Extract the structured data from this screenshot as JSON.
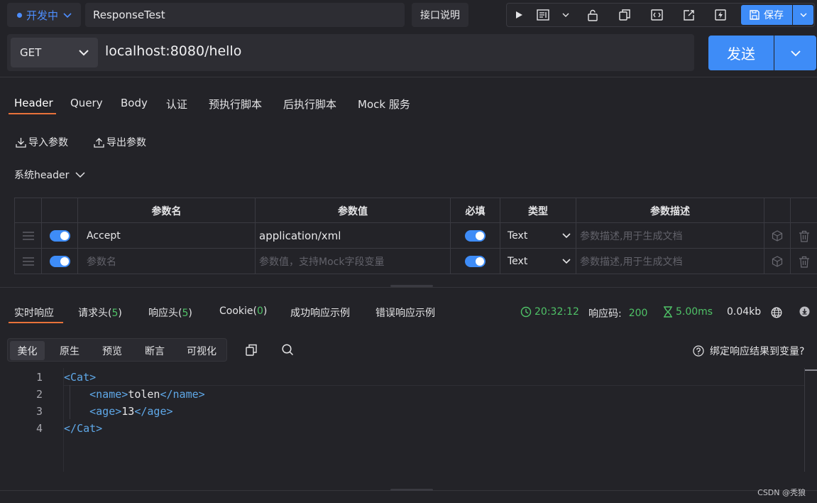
{
  "topbar": {
    "env_label": "开发中",
    "api_name": "ResponseTest",
    "doc_button": "接口说明",
    "save_label": "保存"
  },
  "request": {
    "method": "GET",
    "url": "localhost:8080/hello",
    "send_label": "发送"
  },
  "req_tabs": [
    "Header",
    "Query",
    "Body",
    "认证",
    "预执行脚本",
    "后执行脚本",
    "Mock 服务"
  ],
  "actions": {
    "import": "导入参数",
    "export": "导出参数"
  },
  "system_header_label": "系统header",
  "params_table": {
    "columns": [
      "参数名",
      "参数值",
      "必填",
      "类型",
      "参数描述"
    ],
    "rows": [
      {
        "name": "Accept",
        "value": "application/xml",
        "required": true,
        "type": "Text",
        "desc_placeholder": "参数描述,用于生成文档"
      },
      {
        "name_placeholder": "参数名",
        "value_placeholder": "参数值，支持Mock字段变量",
        "required": true,
        "type": "Text",
        "desc_placeholder": "参数描述,用于生成文档"
      }
    ]
  },
  "response": {
    "tabs": {
      "live": "实时响应",
      "req_headers_label": "请求头(",
      "req_headers_count": "5",
      "res_headers_label": "响应头(",
      "res_headers_count": "5",
      "cookie_label": "Cookie(",
      "cookie_count": "0",
      "close_paren": ")",
      "success_example": "成功响应示例",
      "error_example": "错误响应示例"
    },
    "time": "20:32:12",
    "status_label": "响应码:",
    "status_code": "200",
    "duration": "5.00ms",
    "size": "0.04kb",
    "view_modes": [
      "美化",
      "原生",
      "预览",
      "断言",
      "可视化"
    ],
    "bind_link": "绑定响应结果到变量?",
    "code_lines": [
      {
        "num": "1",
        "indent": "",
        "open": "Cat",
        "text": "",
        "close": ""
      },
      {
        "num": "2",
        "indent": "    ",
        "open": "name",
        "text": "tolen",
        "close": "name"
      },
      {
        "num": "3",
        "indent": "    ",
        "open": "age",
        "text": "13",
        "close": "age"
      },
      {
        "num": "4",
        "indent": "",
        "open": "",
        "text": "",
        "close": "Cat"
      }
    ]
  },
  "watermark": "CSDN @秃狼",
  "colors": {
    "accent": "#3e8cf7",
    "tab_underline": "#e8723a",
    "success": "#4fc267",
    "xml_tag": "#5fa8e8"
  }
}
